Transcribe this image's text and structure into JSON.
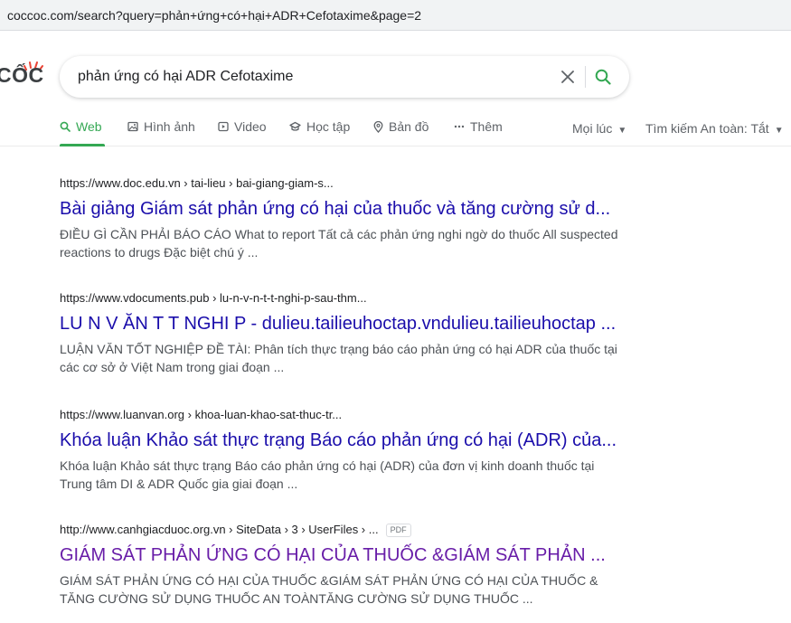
{
  "browser": {
    "url": "coccoc.com/search?query=phản+ứng+có+hại+ADR+Cefotaxime&page=2"
  },
  "logo": {
    "text": "CỐC"
  },
  "search": {
    "query": "phản ứng có hại ADR Cefotaxime"
  },
  "tabs": [
    {
      "label": "Web",
      "icon": "search-icon",
      "active": true
    },
    {
      "label": "Hình ảnh",
      "icon": "image-icon"
    },
    {
      "label": "Video",
      "icon": "video-icon"
    },
    {
      "label": "Học tập",
      "icon": "graduation-cap-icon"
    },
    {
      "label": "Bản đồ",
      "icon": "map-pin-icon"
    },
    {
      "label": "Thêm",
      "icon": "more-dots-icon"
    }
  ],
  "filters": {
    "time": "Mọi lúc",
    "safe_search": "Tìm kiếm An toàn: Tắt"
  },
  "results": [
    {
      "cite": "https://www.doc.edu.vn › tai-lieu › bai-giang-giam-s...",
      "title": "Bài giảng Giám sát phản ứng có hại của thuốc và tăng cường sử d...",
      "snippet": "ĐIỀU GÌ CẦN PHẢI BÁO CÁO What to report Tất cả các phản ứng nghi ngờ do thuốc All suspected reactions to drugs Đặc biệt chú ý ...",
      "visited": false
    },
    {
      "cite": "https://www.vdocuments.pub › lu-n-v-n-t-t-nghi-p-sau-thm...",
      "title": "LU N V ĂN T T NGHI P - dulieu.tailieuhoctap.vndulieu.tailieuhoctap ...",
      "snippet": "LUẬN VĂN TỐT NGHIỆP ĐỀ TÀI: Phân tích thực trạng báo cáo phản ứng có hại ADR của thuốc tại các cơ sở ở Việt Nam trong giai đoạn ...",
      "visited": false
    },
    {
      "cite": "https://www.luanvan.org › khoa-luan-khao-sat-thuc-tr...",
      "title": "Khóa luận Khảo sát thực trạng Báo cáo phản ứng có hại (ADR) của...",
      "snippet": "Khóa luận Khảo sát thực trạng Báo cáo phản ứng có hại (ADR) của đơn vị kinh doanh thuốc tại Trung tâm DI & ADR Quốc gia giai đoạn ...",
      "visited": false
    },
    {
      "cite": "http://www.canhgiacduoc.org.vn › SiteData › 3 › UserFiles › ...",
      "badge": "PDF",
      "title": "GIÁM SÁT PHẢN ỨNG CÓ HẠI CỦA THUỐC &GIÁM SÁT PHẢN ...",
      "snippet": "GIÁM SÁT PHẢN ỨNG CÓ HẠI CỦA THUỐC &GIÁM SÁT PHẢN ỨNG CÓ HẠI CỦA THUỐC & TĂNG CƯỜNG SỬ DỤNG THUỐC AN TOÀNTĂNG CƯỜNG SỬ DỤNG THUỐC ...",
      "visited": true
    }
  ],
  "colors": {
    "accent": "#34a853",
    "link": "#1a0dab",
    "visited_link": "#681da8",
    "logo_sparkle": "#ea4335"
  }
}
